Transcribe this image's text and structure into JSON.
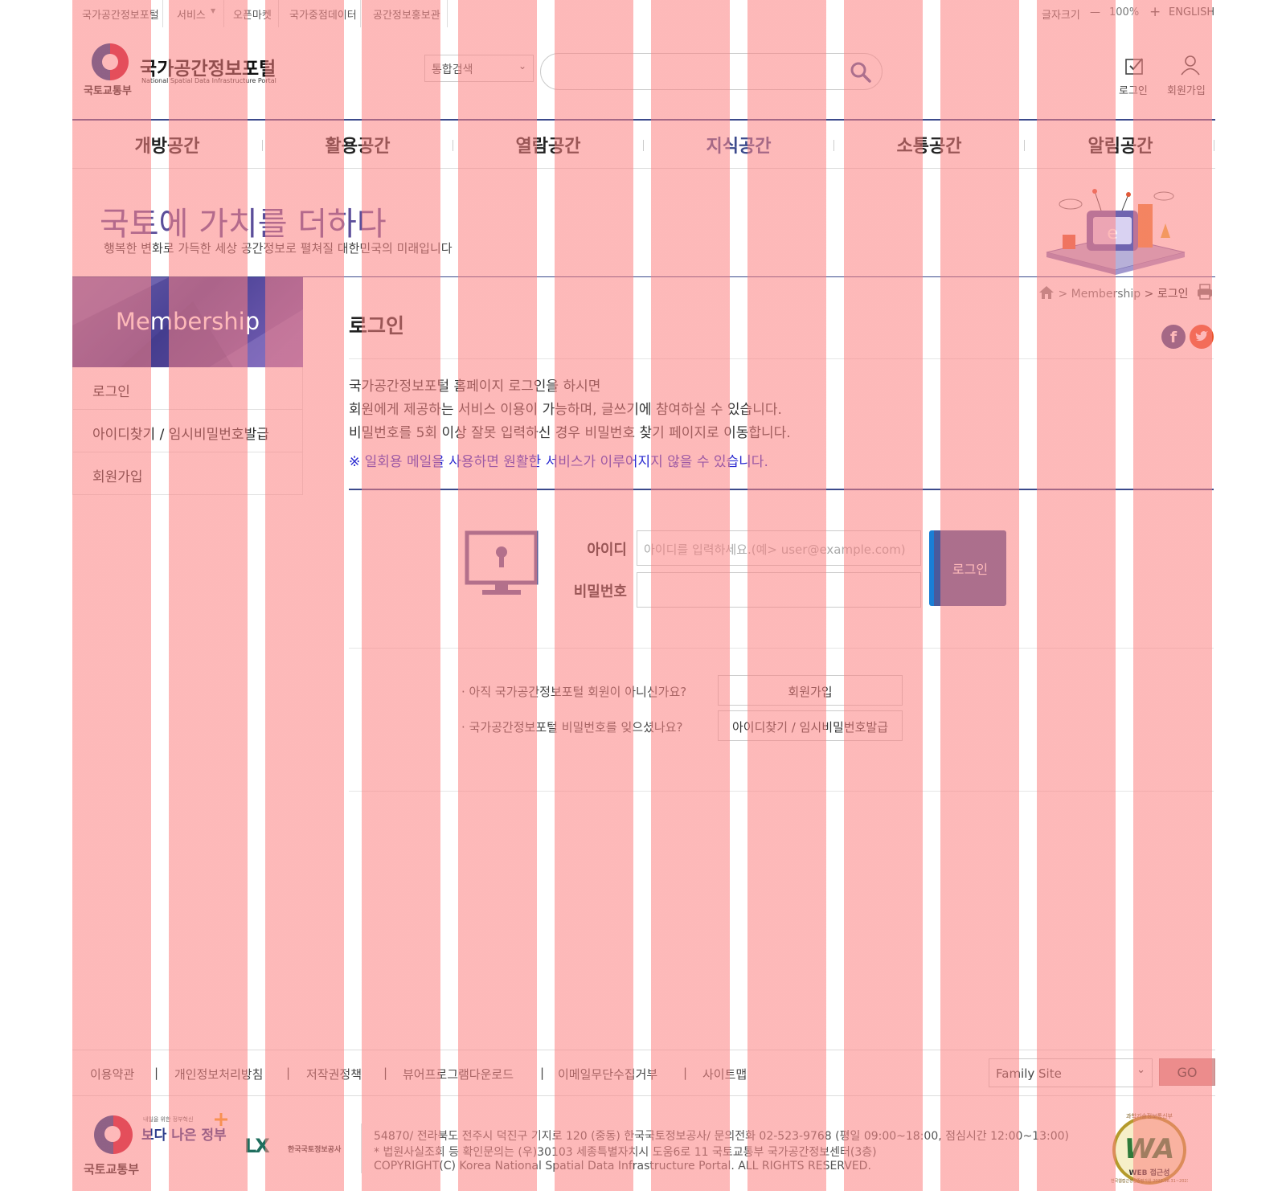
{
  "topbar": {
    "links": [
      "국가공간정보포털",
      "서비스",
      "오픈마켓",
      "국가중점데이터",
      "공간정보홍보관"
    ],
    "font_size_label": "글자크기",
    "minus": "—",
    "zoom": "100%",
    "plus": "+",
    "english": "ENGLISH"
  },
  "header": {
    "logo_title": "국가공간정보포털",
    "logo_subtitle": "National Spatial Data Infrastructure Portal",
    "ministry": "국토교통부",
    "search_select": "통합검색",
    "login": "로그인",
    "join": "회원가입"
  },
  "gnb": [
    "개방공간",
    "활용공간",
    "열람공간",
    "지식공간",
    "소통공간",
    "알림공간"
  ],
  "banner": {
    "title": "국토에 가치를 더하다",
    "subtitle": "행복한 변화로 가득한 세상 공간정보로 펼쳐질 대한민국의 미래입니다"
  },
  "lnb": {
    "title": "Membership",
    "items": [
      "로그인",
      "아이디찾기 / 임시비밀번호발급",
      "회원가입"
    ]
  },
  "breadcrumb": {
    "sep1": ">",
    "section": "Membership",
    "sep2": ">",
    "current": "로그인"
  },
  "content": {
    "title": "로그인",
    "desc": [
      "국가공간정보포털 홈페이지 로그인을 하시면",
      "회원에게 제공하는 서비스 이용이 가능하며, 글쓰기에 참여하실 수 있습니다.",
      "비밀번호를 5회 이상 잘못 입력하신 경우 비밀번호 찾기 페이지로 이동합니다."
    ],
    "notice": "※ 일회용 메일을 사용하면 원활한 서비스가 이루어지지 않을 수 있습니다.",
    "id_label": "아이디",
    "id_placeholder": "아이디를 입력하세요.(예> user@example.com)",
    "pw_label": "비밀번호",
    "login_button": "로그인",
    "q_join": "· 아직 국가공간정보포털 회원이 아니신가요?",
    "join_button": "회원가입",
    "q_find": "· 국가공간정보포털 비밀번호를 잊으셨나요?",
    "find_button": "아이디찾기 / 임시비밀번호발급"
  },
  "footer": {
    "links": [
      "이용약관",
      "개인정보처리방침",
      "저작권정책",
      "뷰어프로그램다운로드",
      "이메일무단수집거부",
      "사이트맵"
    ],
    "link_sep": "|",
    "family_site": "Family Site",
    "go": "GO",
    "gov_small": "내일을 위한 정부혁신",
    "gov_slogan": "보다 나은 정부",
    "ministry": "국토교통부",
    "lx_name": "한국국토정보공사",
    "address": [
      "54870/ 전라북도 전주시 덕진구 기지로 120 (중동) 한국국토정보공사/ 문의전화 02-523-9768 (평일 09:00~18:00, 점심시간 12:00~13:00)",
      "* 법원사실조회 등 확인문의는 (우)30103 세종특별자치시 도움6로 11 국토교통부 국가공간정보센터(3층)",
      "COPYRIGHT(C) Korea National Spatial Data Infrastructure Portal. ALL RIGHTS RESERVED."
    ],
    "wa_top": "과학기술정보통신부",
    "wa_mark": "WA",
    "wa_bottom": "WEB 접근성",
    "wa_edge": "한국웹접근성인증평가원 2022.08.31~2023.08.30"
  },
  "colors": {
    "tint_stripe": "#fc8080",
    "accent_navy": "#3b4a8c",
    "notice_blue": "#2a2ad0",
    "login_button": "#4a5a9c",
    "login_button_edge": "#1a7fd6"
  }
}
